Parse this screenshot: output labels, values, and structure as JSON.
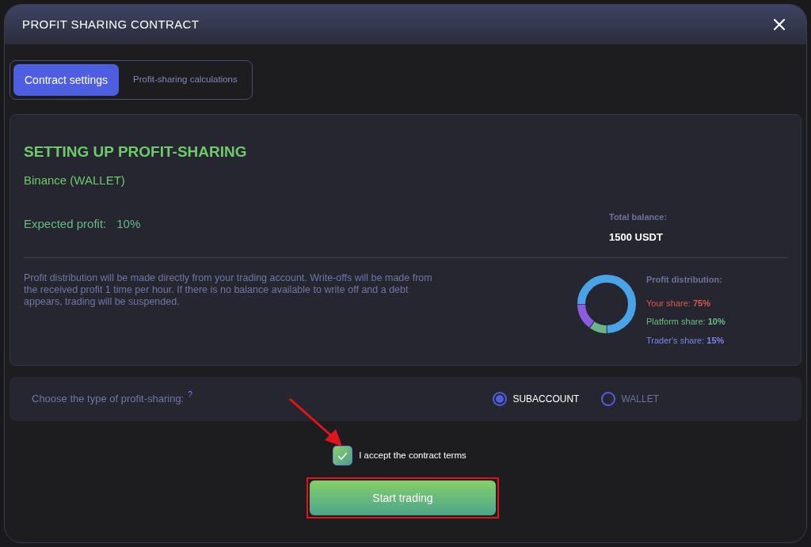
{
  "window": {
    "title": "PROFIT SHARING CONTRACT"
  },
  "tabs": [
    {
      "label": "Contract settings",
      "selected": true
    },
    {
      "label": "Profit-sharing calculations",
      "selected": false
    }
  ],
  "setup": {
    "heading": "SETTING UP PROFIT-SHARING",
    "exchange": "Binance (WALLET)",
    "expected_profit_label": "Expected profit:",
    "expected_profit_value": "10%",
    "total_balance_label": "Total balance:",
    "total_balance_value": "1500 USDT",
    "note": "Profit distribution will be made directly from your trading account. Write-offs will be made from the received profit 1 time per hour. If there is no balance available to write off and a debt appears, trading will be suspended.",
    "distribution_title": "Profit distribution:",
    "shares": [
      {
        "label": "Your share:",
        "value": "75%",
        "color": "#e0574b"
      },
      {
        "label": "Platform share:",
        "value": "10%",
        "color": "#6dbb85"
      },
      {
        "label": "Trader's share:",
        "value": "15%",
        "color": "#7b86e6"
      }
    ]
  },
  "type_choice": {
    "label": "Choose the type of profit-sharing:",
    "help": "?",
    "options": [
      {
        "label": "SUBACCOUNT",
        "selected": true
      },
      {
        "label": "WALLET",
        "selected": false
      }
    ]
  },
  "terms": {
    "label": "I accept the contract terms",
    "checked": true
  },
  "start_button": "Start trading"
}
